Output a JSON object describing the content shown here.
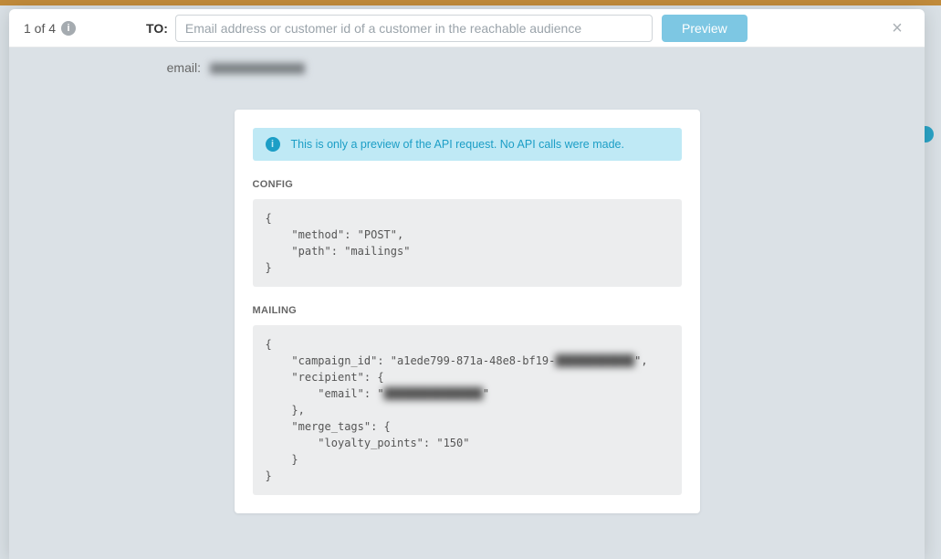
{
  "header": {
    "step": "1 of 4",
    "to_label": "TO:",
    "to_placeholder": "Email address or customer id of a customer in the reachable audience",
    "preview_btn": "Preview"
  },
  "body": {
    "email_label": "email:",
    "email_value": "r█████████",
    "info_message": "This is only a preview of the API request. No API calls were made.",
    "config_heading": "CONFIG",
    "config_code": "{\n    \"method\": \"POST\",\n    \"path\": \"mailings\"\n}",
    "mailing_heading": "MAILING",
    "mailing_code_pre": "{\n    \"campaign_id\": \"a1ede799-871a-48e8-bf19-",
    "mailing_code_blur1": "████████████",
    "mailing_code_mid1": "\",\n    \"recipient\": {\n        \"email\": \"",
    "mailing_code_blur2": "███████████████",
    "mailing_code_post": "\"\n    },\n    \"merge_tags\": {\n        \"loyalty_points\": \"150\"\n    }\n}"
  },
  "chart_data": {
    "type": "table",
    "title": "API Request Preview",
    "config": {
      "method": "POST",
      "path": "mailings"
    },
    "mailing": {
      "campaign_id": "a1ede799-871a-48e8-bf19-[redacted]",
      "recipient": {
        "email": "[redacted]"
      },
      "merge_tags": {
        "loyalty_points": "150"
      }
    }
  }
}
